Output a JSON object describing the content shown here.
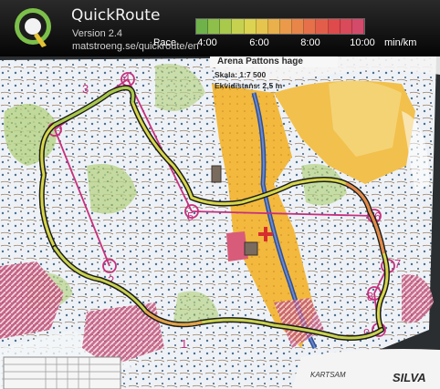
{
  "app": {
    "title": "QuickRoute",
    "version": "Version 2.4",
    "url": "matstroeng.se/quickroute/en"
  },
  "pace_legend": {
    "label": "Pace",
    "ticks": [
      "4:00",
      "6:00",
      "8:00",
      "10:00"
    ],
    "unit": "min/km",
    "colors": [
      "#6fb24a",
      "#8dbf4a",
      "#a9c94c",
      "#c6d24f",
      "#dcd350",
      "#e6c54e",
      "#e9b04c",
      "#ea9a4a",
      "#e8864a",
      "#e67049",
      "#e35e4a",
      "#df4a4c",
      "#d94a5a",
      "#d44a6a"
    ]
  },
  "map": {
    "header_text": "Arena Pattons hage",
    "scale_text": "Skala: 1:7 500",
    "contour_text": "Ekvidistans: 2,5 m",
    "brand_left": "KARTSAM",
    "brand_right": "SILVA",
    "control_numbers": [
      "1",
      "2",
      "3",
      "4",
      "5",
      "6",
      "7",
      "8",
      "9"
    ]
  }
}
